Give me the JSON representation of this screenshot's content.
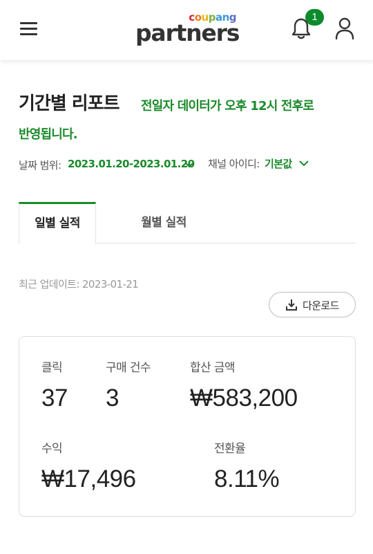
{
  "header": {
    "logo_small": "coupang",
    "logo_big": "partners",
    "notification_count": "1"
  },
  "report": {
    "title": "기간별 리포트",
    "notice_line1": "전일자 데이터가 오후 12시 전후로",
    "notice_line2": "반영됩니다.",
    "date_range_label": "날짜 범위:",
    "date_range_value": "2023.01.20-2023.01.20",
    "channel_label": "채널 아이디:",
    "channel_value": "기본값"
  },
  "tabs": [
    {
      "label": "일별 실적",
      "active": true
    },
    {
      "label": "월별 실적",
      "active": false
    }
  ],
  "last_updated": "최근 업데이트: 2023-01-21",
  "download_label": "다운로드",
  "stats": {
    "clicks_label": "클릭",
    "clicks_value": "37",
    "purchases_label": "구매 건수",
    "purchases_value": "3",
    "total_label": "합산 금액",
    "total_value": "₩583,200",
    "revenue_label": "수익",
    "revenue_value": "₩17,496",
    "conversion_label": "전환율",
    "conversion_value": "8.11%"
  },
  "colors": {
    "accent_green": "#1a8a2a",
    "badge_green": "#0b8b2c"
  },
  "icons": {
    "menu": "hamburger-icon",
    "notifications": "bell-icon",
    "account": "user-icon",
    "dropdown": "chevron-down-icon",
    "download": "download-icon"
  }
}
